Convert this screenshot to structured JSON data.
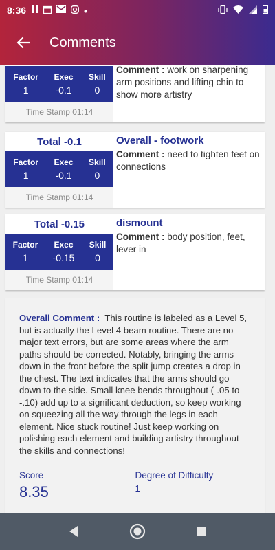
{
  "status_bar": {
    "time": "8:36"
  },
  "app_bar": {
    "title": "Comments"
  },
  "cards": [
    {
      "total": "",
      "factor_label": "Factor",
      "exec_label": "Exec",
      "skill_label": "Skill",
      "factor": "1",
      "exec": "-0.1",
      "skill": "0",
      "timestamp": "Time Stamp 01:14",
      "heading": "",
      "comment_label": "Comment :",
      "comment": "work on sharpening arm positions and lifting chin to show more artistry"
    },
    {
      "total": "Total  -0.1",
      "factor_label": "Factor",
      "exec_label": "Exec",
      "skill_label": "Skill",
      "factor": "1",
      "exec": "-0.1",
      "skill": "0",
      "timestamp": "Time Stamp 01:14",
      "heading": "Overall - footwork",
      "comment_label": "Comment :",
      "comment": "need to tighten feet on connections"
    },
    {
      "total": "Total  -0.15",
      "factor_label": "Factor",
      "exec_label": "Exec",
      "skill_label": "Skill",
      "factor": "1",
      "exec": "-0.15",
      "skill": "0",
      "timestamp": "Time Stamp 01:14",
      "heading": "dismount",
      "comment_label": "Comment :",
      "comment": "body position, feet, lever in"
    }
  ],
  "overall": {
    "label": "Overall Comment :",
    "text": "This routine is labeled as a Level 5, but is actually the Level 4 beam routine. There are no major text errors, but are some areas where the arm paths should be corrected. Notably, bringing the arms down in the front before the split jump creates a drop in the chest. The text indicates that the arms should go down to the side. Small knee bends throughout (-.05 to -.10) add up to a significant deduction, so keep working on squeezing all the way through the legs in each element. Nice stuck routine! Just keep working on polishing each element and building artistry throughout the skills and connections!",
    "score_label": "Score",
    "score": "8.35",
    "dd_label": "Degree of Difficulty",
    "dd": "1"
  }
}
